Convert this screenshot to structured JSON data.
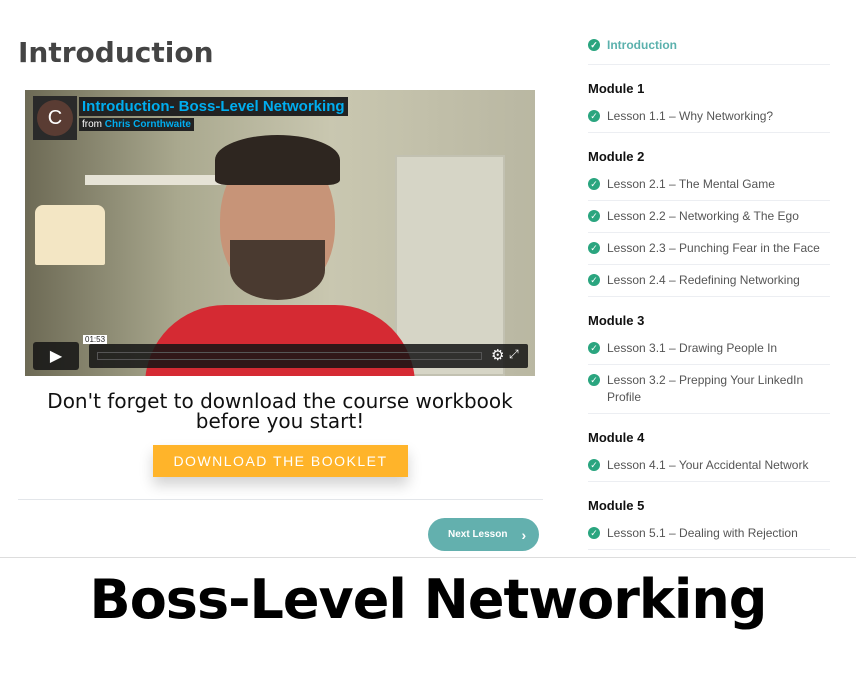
{
  "page_title": "Introduction",
  "video": {
    "avatar_letter": "C",
    "title": "Introduction- Boss-Level Networking",
    "from_label": "from",
    "author": "Chris Cornthwaite",
    "time": "01:53"
  },
  "message": "Don't forget to download the course workbook before you start!",
  "download_button": "DOWNLOAD THE BOOKLET",
  "next_button": "Next Lesson",
  "sidebar": {
    "intro": "Introduction",
    "modules": [
      {
        "title": "Module 1",
        "lessons": [
          "Lesson 1.1 – Why Networking?"
        ]
      },
      {
        "title": "Module 2",
        "lessons": [
          "Lesson 2.1 – The Mental Game",
          "Lesson 2.2 – Networking & The Ego",
          "Lesson 2.3 – Punching Fear in the Face",
          "Lesson 2.4 – Redefining Networking"
        ]
      },
      {
        "title": "Module 3",
        "lessons": [
          "Lesson 3.1 – Drawing People In",
          "Lesson 3.2 – Prepping Your LinkedIn Profile"
        ]
      },
      {
        "title": "Module 4",
        "lessons": [
          "Lesson 4.1 – Your Accidental Network"
        ]
      },
      {
        "title": "Module 5",
        "lessons": [
          "Lesson 5.1 – Dealing with Rejection"
        ]
      }
    ]
  },
  "banner": "Boss-Level Networking",
  "colors": {
    "accent": "#63b0ae",
    "button": "#ffb42a",
    "check": "#2aa57f"
  }
}
